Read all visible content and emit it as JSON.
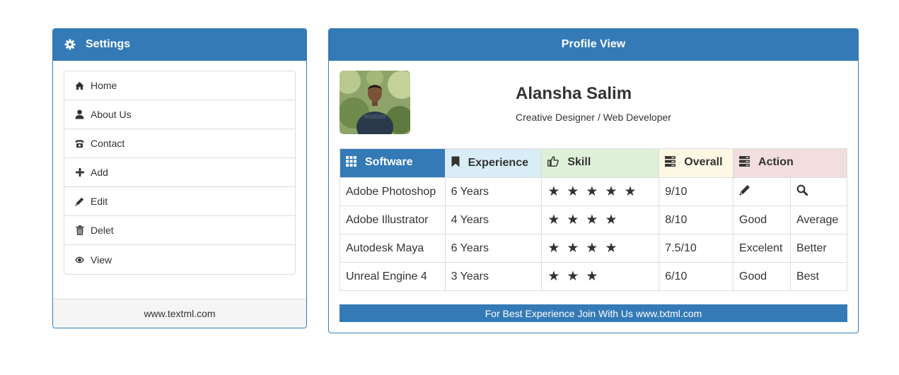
{
  "settings": {
    "title": "Settings",
    "icon": "gear-icon",
    "items": [
      {
        "label": "Home",
        "icon": "home-icon"
      },
      {
        "label": "About Us",
        "icon": "user-icon"
      },
      {
        "label": "Contact",
        "icon": "phone-icon"
      },
      {
        "label": "Add",
        "icon": "plus-icon"
      },
      {
        "label": "Edit",
        "icon": "pencil-icon"
      },
      {
        "label": "Delet",
        "icon": "trash-icon"
      },
      {
        "label": "View",
        "icon": "eye-icon"
      }
    ],
    "footer": "www.textml.com"
  },
  "profile": {
    "title": "Profile View",
    "name": "Alansha Salim",
    "role": "Creative Designer / Web Developer",
    "table": {
      "headers": {
        "software": "Software",
        "experience": "Experience",
        "skill": "Skill",
        "overall": "Overall",
        "action": "Action"
      },
      "rows": [
        {
          "software": "Adobe Photoshop",
          "experience": "6 Years",
          "stars": 5,
          "overall": "9/10",
          "action1": "",
          "action2": ""
        },
        {
          "software": "Adobe Illustrator",
          "experience": "4 Years",
          "stars": 4,
          "overall": "8/10",
          "action1": "Good",
          "action2": "Average"
        },
        {
          "software": "Autodesk Maya",
          "experience": "6 Years",
          "stars": 4,
          "overall": "7.5/10",
          "action1": "Excelent",
          "action2": "Better"
        },
        {
          "software": "Unreal Engine 4",
          "experience": "3 Years",
          "stars": 3,
          "overall": "6/10",
          "action1": "Good",
          "action2": "Best"
        }
      ]
    },
    "footer": "For Best Experience Join With Us www.txtml.com"
  },
  "colors": {
    "primary": "#337ab7",
    "info": "#d9edf7",
    "success": "#dff0d8",
    "warning": "#fcf8e3",
    "danger": "#f2dede"
  }
}
